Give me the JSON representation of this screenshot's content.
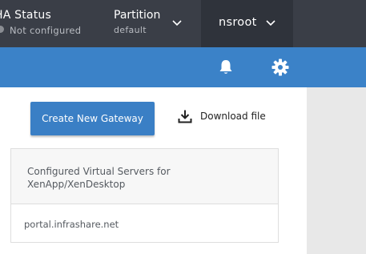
{
  "topbar": {
    "ha_status": {
      "title": "HA Status",
      "state": "Not configured"
    },
    "partition": {
      "title": "Partition",
      "value": "default"
    },
    "user": {
      "name": "nsroot"
    }
  },
  "toolbar": {
    "icons": [
      "bell-icon",
      "gear-icon"
    ]
  },
  "actions": {
    "create_label": "Create New Gateway",
    "download_label": "Download file"
  },
  "servers": {
    "header": "Configured Virtual Servers for XenApp/XenDesktop",
    "items": [
      {
        "name": "portal.infrashare.net"
      }
    ]
  },
  "colors": {
    "topbar": "#3a3e47",
    "user_menu": "#2f333b",
    "accent_bar": "#3b82c8",
    "button": "#3a7fc5"
  }
}
